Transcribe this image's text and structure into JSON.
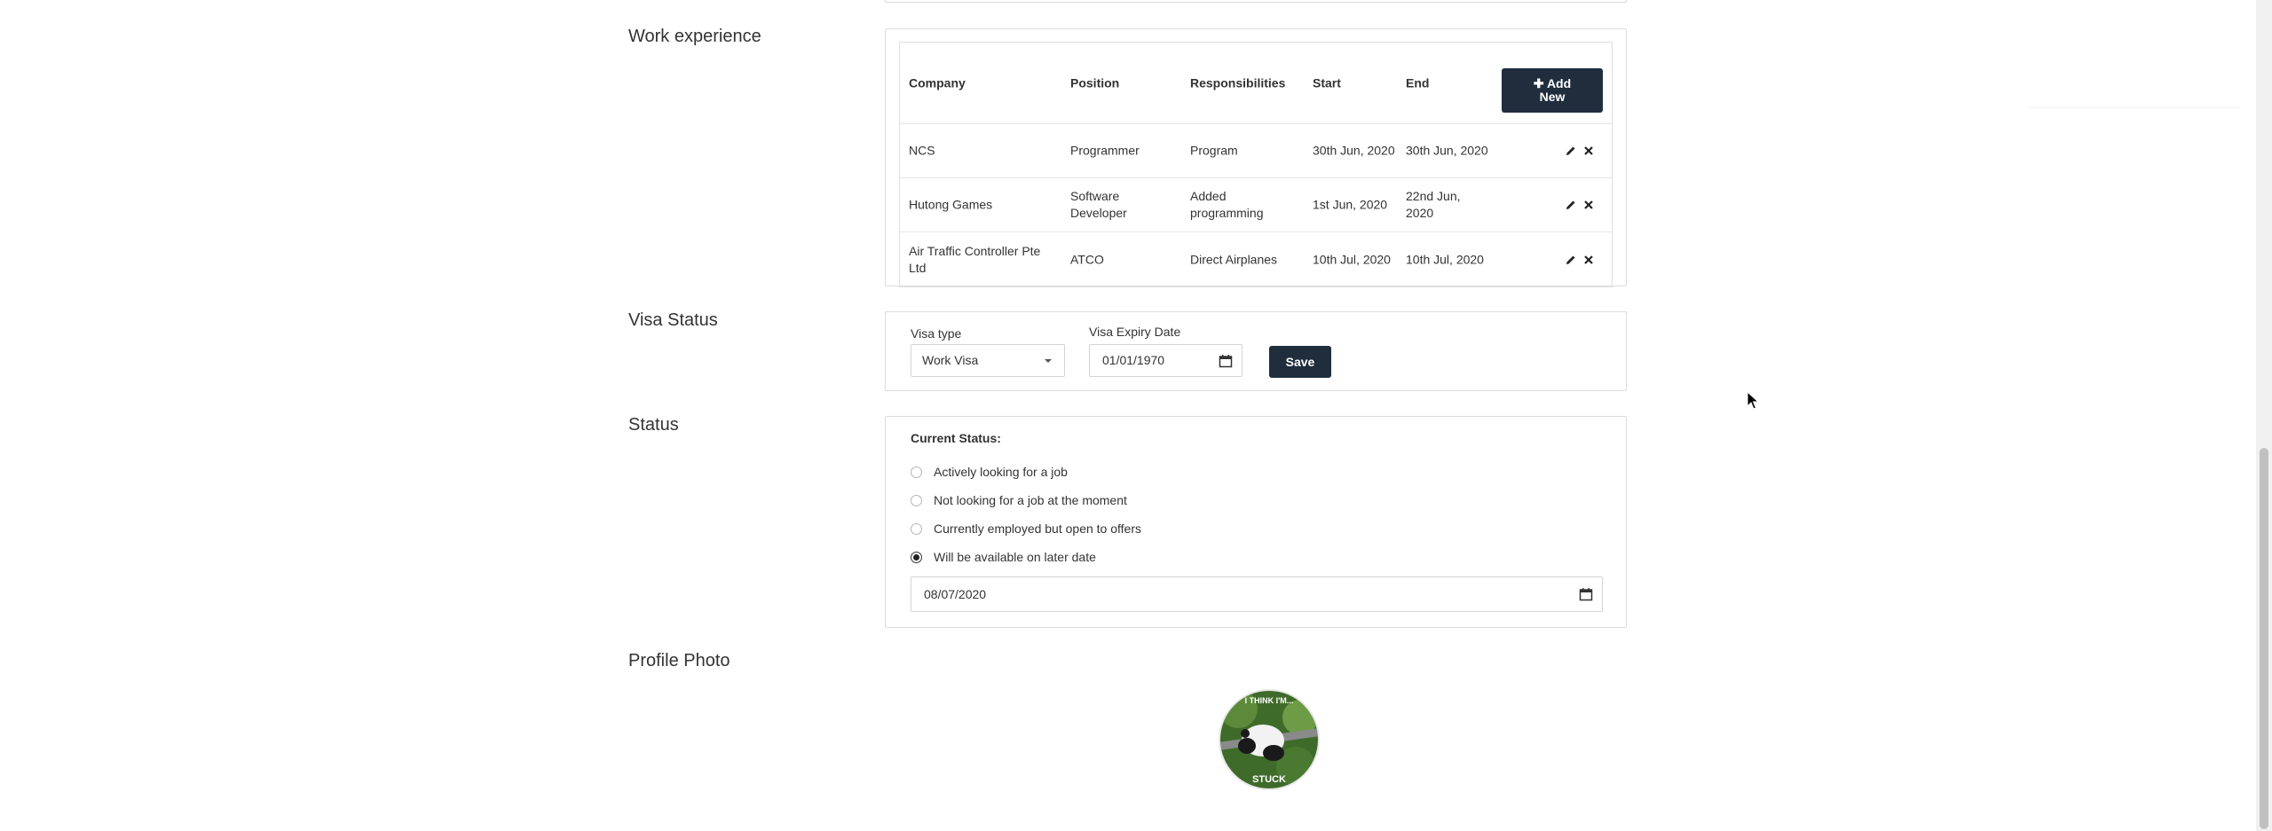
{
  "work_experience": {
    "title": "Work experience",
    "add_button_label": "Add New",
    "columns": [
      "Company",
      "Position",
      "Responsibilities",
      "Start",
      "End"
    ],
    "rows": [
      {
        "company": "NCS",
        "position": "Programmer",
        "responsibilities": "Program",
        "start": "30th Jun, 2020",
        "end": "30th Jun, 2020"
      },
      {
        "company": "Hutong Games",
        "position": "Software Developer",
        "responsibilities": "Added programming",
        "start": "1st Jun, 2020",
        "end": "22nd Jun, 2020"
      },
      {
        "company": "Air Traffic Controller Pte Ltd",
        "position": "ATCO",
        "responsibilities": "Direct Airplanes",
        "start": "10th Jul, 2020",
        "end": "10th Jul, 2020"
      }
    ]
  },
  "visa": {
    "title": "Visa Status",
    "type_label": "Visa type",
    "type_value": "Work Visa",
    "expiry_label": "Visa Expiry Date",
    "expiry_value": "01/01/1970",
    "save_label": "Save"
  },
  "status": {
    "title": "Status",
    "heading": "Current Status:",
    "options": [
      {
        "label": "Actively looking for a job",
        "checked": false
      },
      {
        "label": "Not looking for a job at the moment",
        "checked": false
      },
      {
        "label": "Currently employed but open to offers",
        "checked": false
      },
      {
        "label": "Will be available on later date",
        "checked": true
      }
    ],
    "available_date": "08/07/2020"
  },
  "profile_photo": {
    "title": "Profile Photo",
    "caption_top": "I THINK I'M...",
    "caption_bottom": "STUCK"
  },
  "colors": {
    "button_bg": "#1f2d3d",
    "border": "#dcdcdc"
  }
}
